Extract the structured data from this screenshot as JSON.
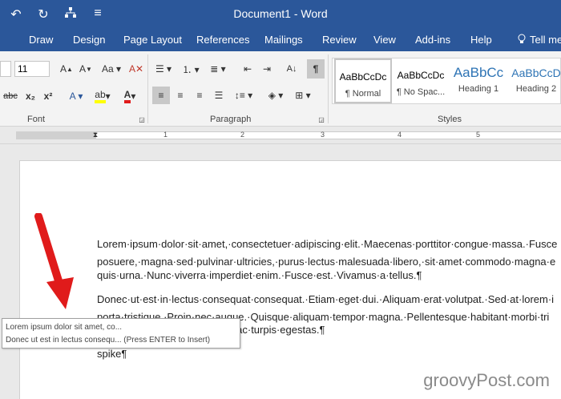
{
  "window": {
    "title": "Document1  -  Word"
  },
  "qat": {
    "undo": "↶",
    "redo": "↻",
    "customize": "≡"
  },
  "menu": {
    "tabs": [
      "Draw",
      "Design",
      "Page Layout",
      "References",
      "Mailings",
      "Review",
      "View",
      "Add-ins",
      "Help"
    ],
    "tell_me": "Tell me"
  },
  "ribbon": {
    "font_size": "11",
    "font_group_label": "Font",
    "paragraph_group_label": "Paragraph",
    "styles_group_label": "Styles",
    "styles": [
      {
        "preview": "AaBbCcDc",
        "name": "¶ Normal"
      },
      {
        "preview": "AaBbCcDc",
        "name": "¶ No Spac..."
      },
      {
        "preview": "AaBbCc",
        "name": "Heading 1"
      },
      {
        "preview": "AaBbCcD",
        "name": "Heading 2"
      }
    ]
  },
  "ruler": {
    "numbers": [
      "1",
      "2",
      "3",
      "4",
      "5"
    ]
  },
  "document": {
    "paragraph1": [
      "Lorem·ipsum·dolor·sit·amet,·consectetuer·adipiscing·elit.·Maecenas·porttitor·congue·massa.·Fusce",
      "posuere,·magna·sed·pulvinar·ultricies,·purus·lectus·malesuada·libero,·sit·amet·commodo·magna·e",
      "quis·urna.·Nunc·viverra·imperdiet·enim.·Fusce·est.·Vivamus·a·tellus.¶"
    ],
    "paragraph2": [
      "Donec·ut·est·in·lectus·consequat·consequat.·Etiam·eget·dui.·Aliquam·erat·volutpat.·Sed·at·lorem·i",
      "porta·tristique.·Proin·nec·augue.·Quisque·aliquam·tempor·magna.·Pellentesque·habitant·morbi·tri",
      "et·netus·et·malesuada·fames·ac·turpis·egestas.¶"
    ],
    "current_line": "spike¶"
  },
  "autocomplete": {
    "line1": "Lorem ipsum dolor sit amet, co...",
    "line2": "Donec ut est in lectus consequ... (Press ENTER to Insert)"
  },
  "watermark": {
    "text": "groovyPost.com"
  },
  "colors": {
    "word_blue": "#2b579a",
    "arrow_red": "#e01b1b"
  }
}
